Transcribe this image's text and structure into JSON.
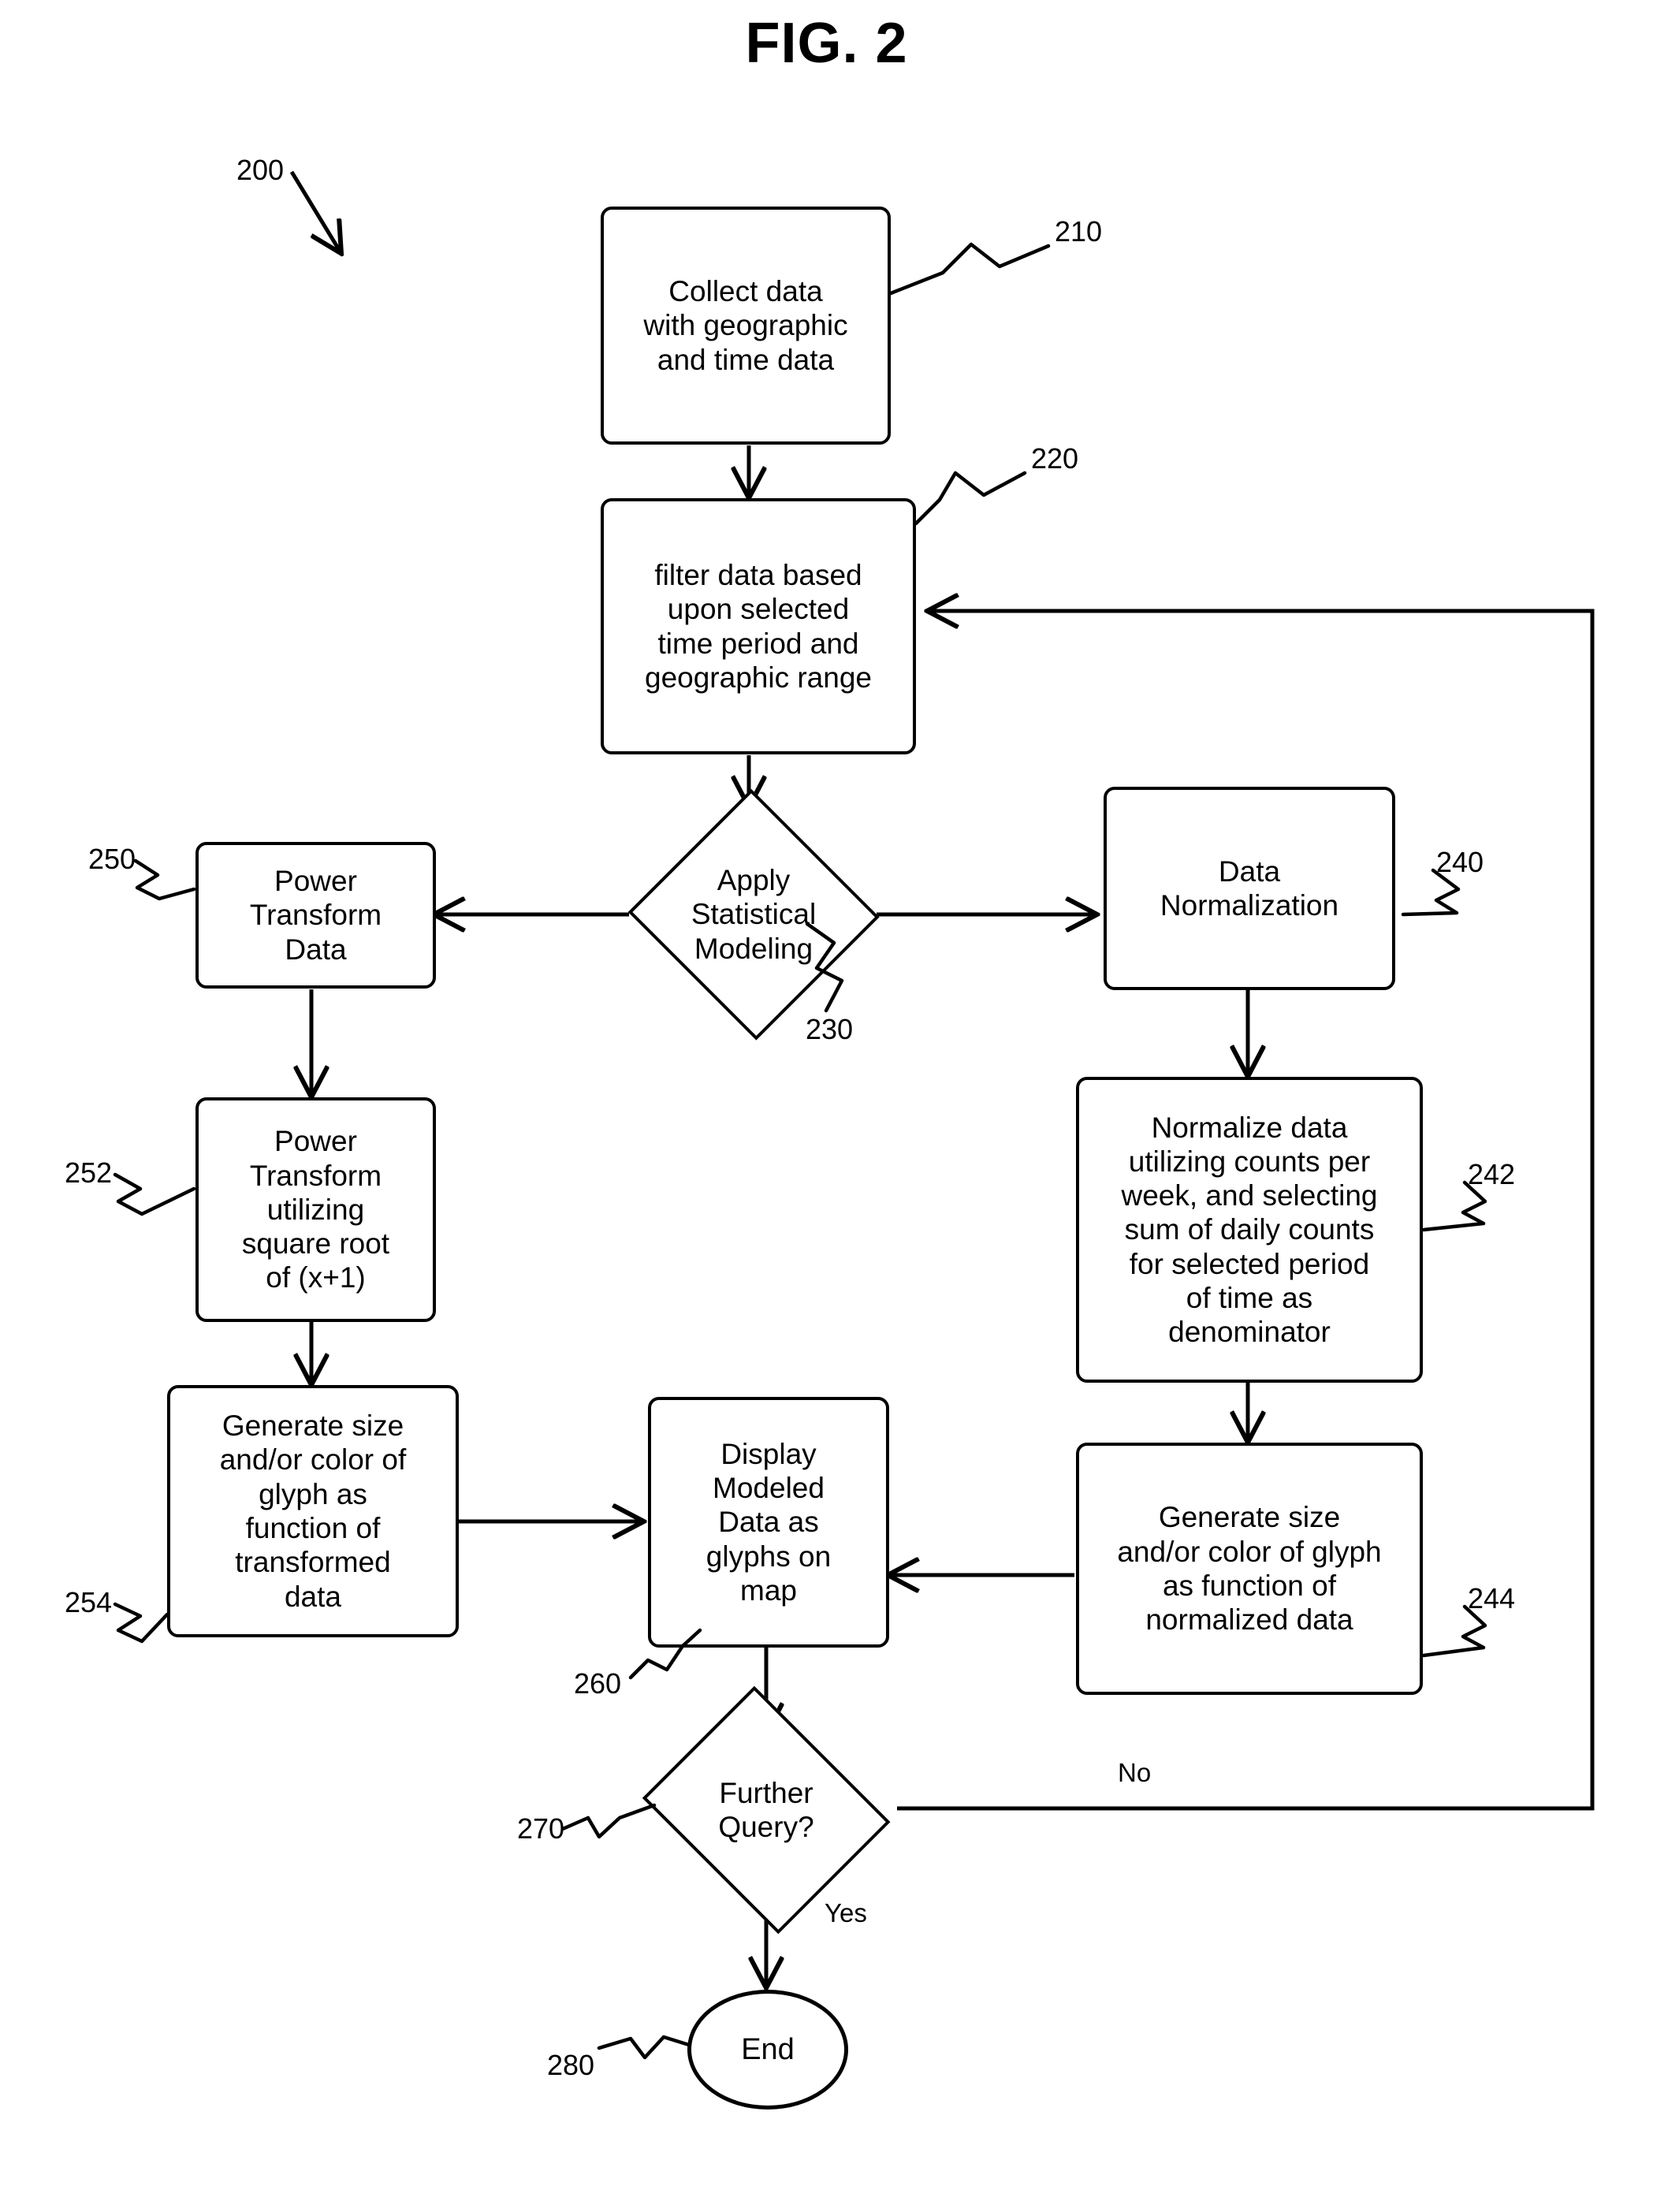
{
  "figure": {
    "title": "FIG. 2",
    "diagram_ref": "200"
  },
  "nodes": {
    "collect": {
      "ref": "210",
      "text": "Collect data\nwith geographic\nand time data",
      "shape": "process"
    },
    "filter": {
      "ref": "220",
      "text": "filter data based\nupon selected\ntime period and\ngeographic range",
      "shape": "process"
    },
    "apply_model": {
      "ref": "230",
      "text": "Apply\nStatistical\nModeling",
      "shape": "decision"
    },
    "power_transform": {
      "ref": "250",
      "text": "Power\nTransform\nData",
      "shape": "process"
    },
    "power_transform_sqrt": {
      "ref": "252",
      "text": "Power\nTransform\nutilizing\nsquare root\nof (x+1)",
      "shape": "process"
    },
    "glyph_transformed": {
      "ref": "254",
      "text": "Generate size\nand/or color of\nglyph as\nfunction of\ntransformed\ndata",
      "shape": "process"
    },
    "data_normalization": {
      "ref": "240",
      "text": "Data\nNormalization",
      "shape": "process"
    },
    "normalize_counts": {
      "ref": "242",
      "text": "Normalize data\nutilizing counts per\nweek, and selecting\nsum of daily counts\nfor selected period\nof time as\ndenominator",
      "shape": "process"
    },
    "glyph_normalized": {
      "ref": "244",
      "text": "Generate size\nand/or color of glyph\nas function of\nnormalized data",
      "shape": "process"
    },
    "display_map": {
      "ref": "260",
      "text": "Display\nModeled\nData as\nglyphs on\nmap",
      "shape": "process"
    },
    "further_query": {
      "ref": "270",
      "text": "Further\nQuery?",
      "shape": "decision"
    },
    "end": {
      "ref": "280",
      "text": "End",
      "shape": "terminator"
    }
  },
  "branch_labels": {
    "no": "No",
    "yes": "Yes"
  }
}
